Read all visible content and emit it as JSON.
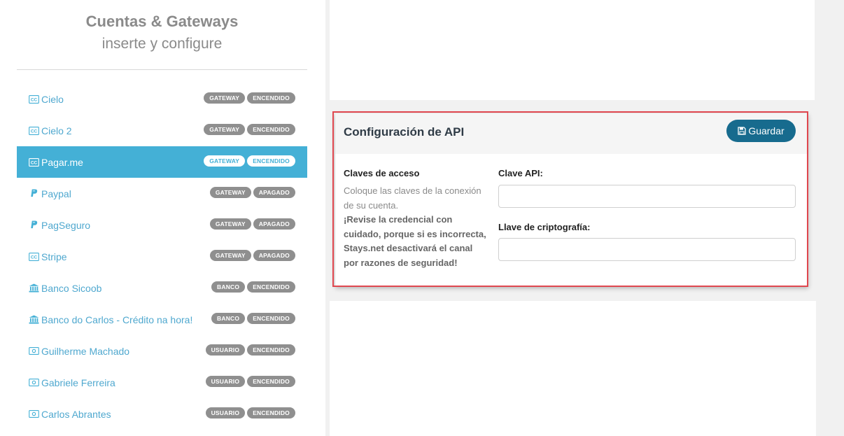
{
  "sidebar": {
    "title": "Cuentas & Gateways",
    "subtitle": "inserte y configure",
    "items": [
      {
        "name": "Cielo",
        "icon": "credit-card-icon",
        "badges": [
          "GATEWAY",
          "ENCENDIDO"
        ],
        "active": false
      },
      {
        "name": "Cielo 2",
        "icon": "credit-card-icon",
        "badges": [
          "GATEWAY",
          "ENCENDIDO"
        ],
        "active": false
      },
      {
        "name": "Pagar.me",
        "icon": "credit-card-icon",
        "badges": [
          "GATEWAY",
          "ENCENDIDO"
        ],
        "active": true
      },
      {
        "name": "Paypal",
        "icon": "paypal-icon",
        "badges": [
          "GATEWAY",
          "APAGADO"
        ],
        "active": false
      },
      {
        "name": "PagSeguro",
        "icon": "paypal-icon",
        "badges": [
          "GATEWAY",
          "APAGADO"
        ],
        "active": false
      },
      {
        "name": "Stripe",
        "icon": "credit-card-icon",
        "badges": [
          "GATEWAY",
          "APAGADO"
        ],
        "active": false
      },
      {
        "name": "Banco Sicoob",
        "icon": "bank-icon",
        "badges": [
          "BANCO",
          "ENCENDIDO"
        ],
        "active": false
      },
      {
        "name": "Banco do Carlos - Crédito na hora!",
        "icon": "bank-icon",
        "badges": [
          "BANCO",
          "ENCENDIDO"
        ],
        "active": false
      },
      {
        "name": "Guilherme Machado",
        "icon": "money-icon",
        "badges": [
          "USUARIO",
          "ENCENDIDO"
        ],
        "active": false
      },
      {
        "name": "Gabriele Ferreira",
        "icon": "money-icon",
        "badges": [
          "USUARIO",
          "ENCENDIDO"
        ],
        "active": false
      },
      {
        "name": "Carlos Abrantes",
        "icon": "money-icon",
        "badges": [
          "USUARIO",
          "ENCENDIDO"
        ],
        "active": false
      }
    ]
  },
  "api_config": {
    "title": "Configuración de API",
    "save_label": "Guardar",
    "section_title": "Claves de acceso",
    "section_text": "Coloque las claves de la conexión de su cuenta.",
    "section_warning": "¡Revise la credencial con cuidado, porque si es incorrecta, Stays.net desactivará el canal por razones de seguridad!",
    "api_key_label": "Clave API:",
    "api_key_value": "",
    "crypto_key_label": "Llave de criptografía:",
    "crypto_key_value": ""
  },
  "colors": {
    "accent": "#44b0d6",
    "primary_button": "#176b8e",
    "badge": "#8f8f8f",
    "highlight": "#e0474f"
  }
}
